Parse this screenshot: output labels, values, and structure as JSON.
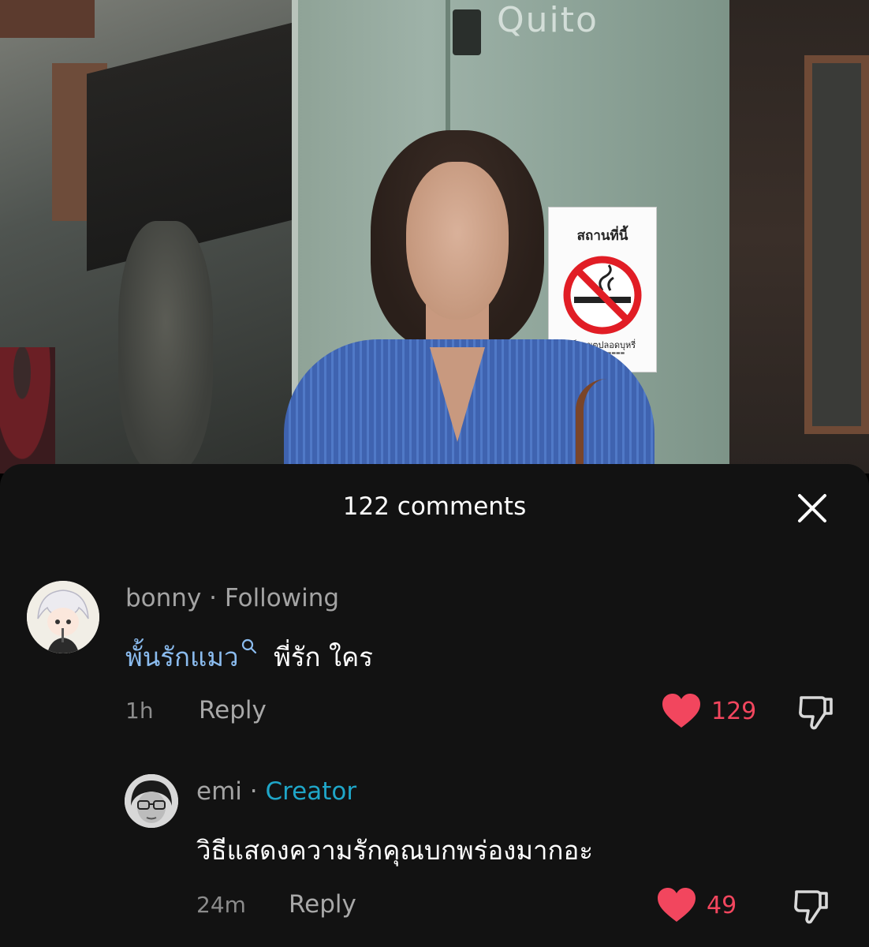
{
  "photo": {
    "graffiti_text": "Quito",
    "sign": {
      "top_text": "สถานที่นี้",
      "bottom_text": "เป็นเขตปลอดบุหรี่"
    }
  },
  "sheet": {
    "title": "122 comments",
    "close_icon": "close-icon"
  },
  "comments": [
    {
      "username": "bonny",
      "separator": "·",
      "badge": "Following",
      "text_link": "พั้นรักแมว",
      "text_rest": "พี่รัก ใคร",
      "time": "1h",
      "reply_label": "Reply",
      "likes": "129",
      "liked": true
    },
    {
      "username": "emi",
      "separator": "·",
      "badge": "Creator",
      "text": "วิธีแสดงความรักคุณบกพร่องมากอะ",
      "time": "24m",
      "reply_label": "Reply",
      "likes": "49",
      "liked": true
    }
  ],
  "colors": {
    "sheet_bg": "#121212",
    "like_red": "#f2465e",
    "creator_blue": "#1fa6c8",
    "link_blue": "#8bbcef"
  }
}
